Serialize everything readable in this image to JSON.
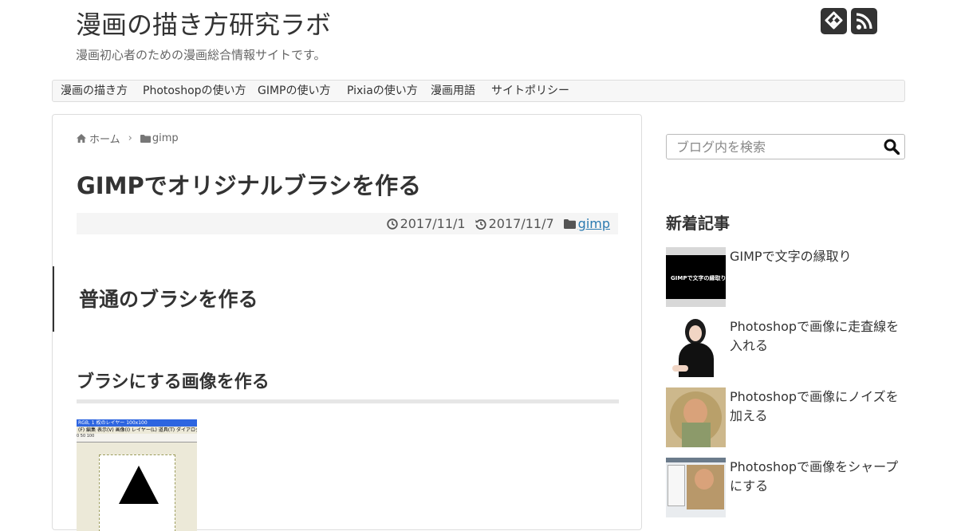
{
  "site": {
    "title": "漫画の描き方研究ラボ",
    "description": "漫画初心者のための漫画総合情報サイトです。"
  },
  "header_icons": [
    "feedly-icon",
    "rss-icon"
  ],
  "nav": {
    "items": [
      {
        "label": "漫画の描き方"
      },
      {
        "label": "Photoshopの使い方"
      },
      {
        "label": "GIMPの使い方"
      },
      {
        "label": "Pixiaの使い方"
      },
      {
        "label": "漫画用語"
      },
      {
        "label": "サイトポリシー"
      }
    ]
  },
  "breadcrumb": {
    "home": "ホーム",
    "category": "gimp"
  },
  "article": {
    "title": "GIMPでオリジナルブラシを作る",
    "published": "2017/11/1",
    "updated": "2017/11/7",
    "category": "gimp",
    "h2": "普通のブラシを作る",
    "h3": "ブラシにする画像を作る"
  },
  "screenshot": {
    "titlebar": "RGB, 1 枚のレイヤー 100x100",
    "menubar": "(F) 編集 表示(V) 画像(I) レイヤー(L) 道具(T) ダイアログ(D)",
    "ruler": "0     50     100"
  },
  "sidebar": {
    "search_placeholder": "ブログ内を検索",
    "recent_heading": "新着記事",
    "recent_posts": [
      {
        "title": "GIMPで文字の縁取り",
        "thumb_text": "GIMPで文字の縁取り"
      },
      {
        "title": "Photoshopで画像に走査線を入れる"
      },
      {
        "title": "Photoshopで画像にノイズを加える"
      },
      {
        "title": "Photoshopで画像をシャープにする"
      }
    ]
  },
  "colors": {
    "text": "#333333",
    "link": "#2a7ab0",
    "nav_bg": "#f7f7f7",
    "meta_bg": "#f5f5f5",
    "border": "#dddddd"
  }
}
